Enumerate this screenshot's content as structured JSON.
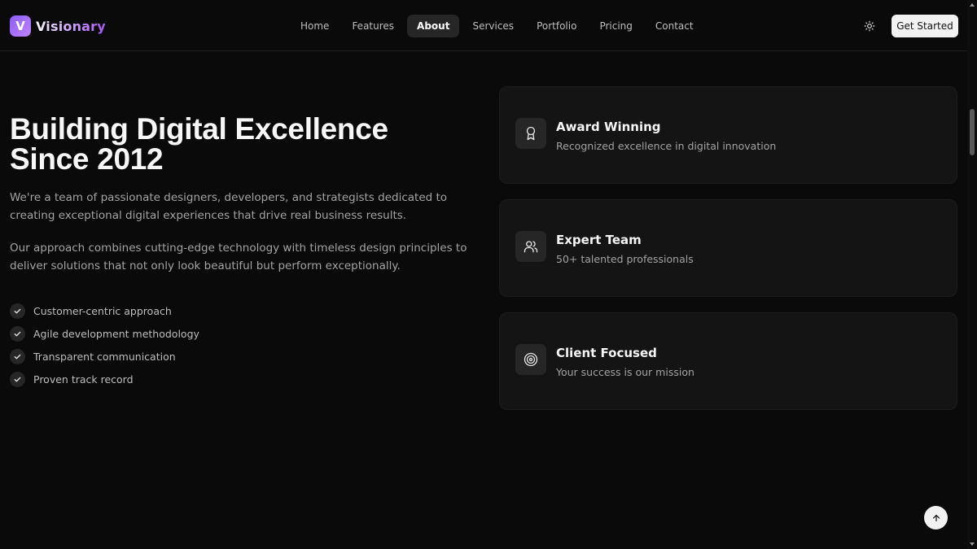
{
  "brand": {
    "initial": "V",
    "name": "Visionary"
  },
  "nav": [
    {
      "label": "Home",
      "active": false
    },
    {
      "label": "Features",
      "active": false
    },
    {
      "label": "About",
      "active": true
    },
    {
      "label": "Services",
      "active": false
    },
    {
      "label": "Portfolio",
      "active": false
    },
    {
      "label": "Pricing",
      "active": false
    },
    {
      "label": "Contact",
      "active": false
    }
  ],
  "header": {
    "theme_icon": "sun-icon",
    "cta_label": "Get Started"
  },
  "about": {
    "title_line1": "Building Digital Excellence",
    "title_line2": "Since 2012",
    "paragraph1": "We're a team of passionate designers, developers, and strategists dedicated to creating exceptional digital experiences that drive real business results.",
    "paragraph2": "Our approach combines cutting-edge technology with timeless design principles to deliver solutions that not only look beautiful but perform exceptionally.",
    "checklist": [
      "Customer-centric approach",
      "Agile development methodology",
      "Transparent communication",
      "Proven track record"
    ]
  },
  "cards": [
    {
      "icon": "award-icon",
      "title": "Award Winning",
      "description": "Recognized excellence in digital innovation"
    },
    {
      "icon": "users-icon",
      "title": "Expert Team",
      "description": "50+ talented professionals"
    },
    {
      "icon": "target-icon",
      "title": "Client Focused",
      "description": "Your success is our mission"
    }
  ],
  "colors": {
    "background": "#0a0a0a",
    "card": "#141414",
    "accent": "#a855f7",
    "text_muted": "#a3a3a3"
  },
  "scroll_top_icon": "arrow-up-icon"
}
